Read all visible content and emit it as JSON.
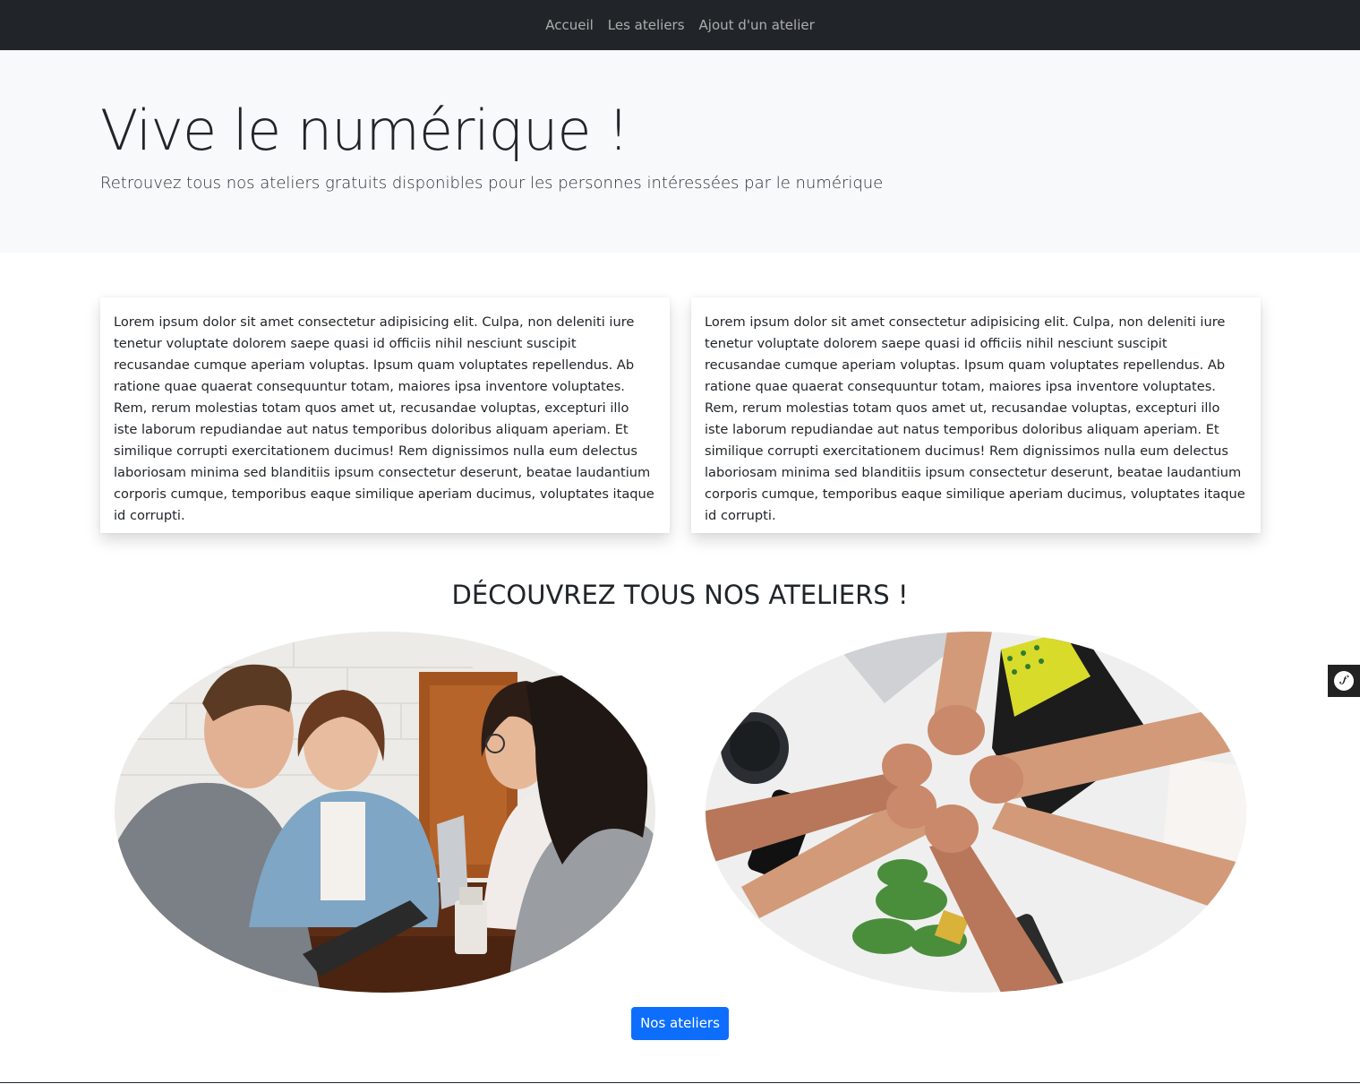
{
  "nav": {
    "items": [
      {
        "label": "Accueil"
      },
      {
        "label": "Les ateliers"
      },
      {
        "label": "Ajout d'un atelier"
      }
    ]
  },
  "hero": {
    "title": "Vive le numérique !",
    "lead": "Retrouvez tous nos ateliers gratuits disponibles pour les personnes intéressées par le numérique"
  },
  "cards": [
    {
      "text": "Lorem ipsum dolor sit amet consectetur adipisicing elit. Culpa, non deleniti iure tenetur voluptate dolorem saepe quasi id officiis nihil nesciunt suscipit recusandae cumque aperiam voluptas. Ipsum quam voluptates repellendus. Ab ratione quae quaerat consequuntur totam, maiores ipsa inventore voluptates. Rem, rerum molestias totam quos amet ut, recusandae voluptas, excepturi illo iste laborum repudiandae aut natus temporibus doloribus aliquam aperiam. Et similique corrupti exercitationem ducimus! Rem dignissimos nulla eum delectus laboriosam minima sed blanditiis ipsum consectetur deserunt, beatae laudantium corporis cumque, temporibus eaque similique aperiam ducimus, voluptates itaque id corrupti."
    },
    {
      "text": "Lorem ipsum dolor sit amet consectetur adipisicing elit. Culpa, non deleniti iure tenetur voluptate dolorem saepe quasi id officiis nihil nesciunt suscipit recusandae cumque aperiam voluptas. Ipsum quam voluptates repellendus. Ab ratione quae quaerat consequuntur totam, maiores ipsa inventore voluptates. Rem, rerum molestias totam quos amet ut, recusandae voluptas, excepturi illo iste laborum repudiandae aut natus temporibus doloribus aliquam aperiam. Et similique corrupti exercitationem ducimus! Rem dignissimos nulla eum delectus laboriosam minima sed blanditiis ipsum consectetur deserunt, beatae laudantium corporis cumque, temporibus eaque similique aperiam ducimus, voluptates itaque id corrupti."
    }
  ],
  "section": {
    "title": "DÉCOUVREZ TOUS NOS ATELIERS !"
  },
  "images": [
    {
      "icon": "people-meeting-photo"
    },
    {
      "icon": "hands-fist-bump-photo"
    }
  ],
  "cta": {
    "label": "Nos ateliers"
  },
  "toolbar": {
    "icon": "symfony-icon"
  },
  "colors": {
    "navbar": "#212529",
    "hero_bg": "#f8f9fa",
    "primary": "#0d6efd"
  }
}
